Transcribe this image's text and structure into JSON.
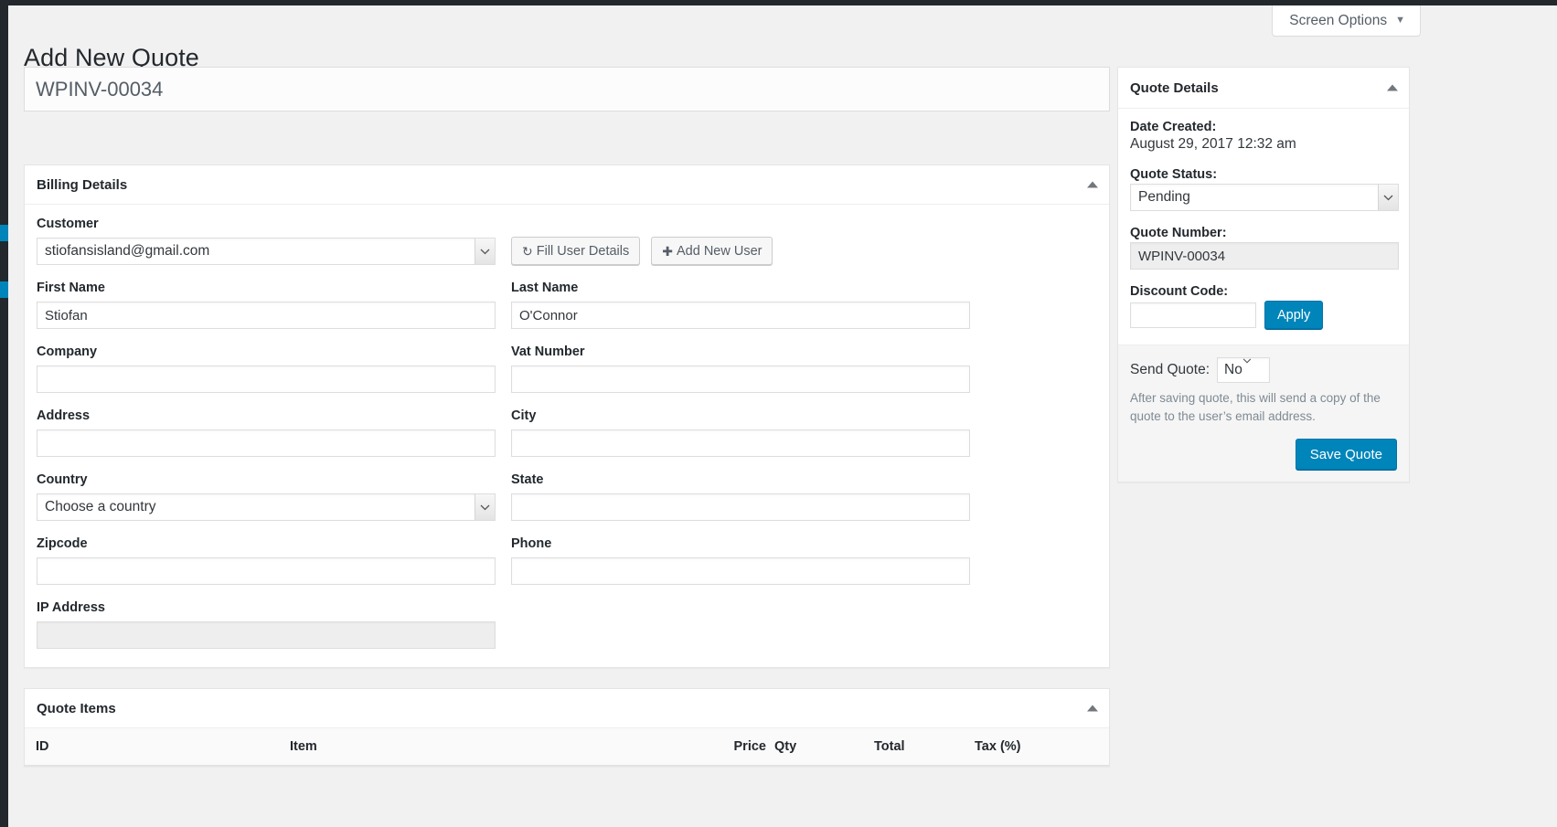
{
  "page": {
    "title": "Add New Quote",
    "quote_title_value": "WPINV-00034"
  },
  "screen_meta": {
    "screen_options_label": "Screen Options",
    "caret": "▼"
  },
  "billing": {
    "panel_title": "Billing Details",
    "customer": {
      "label": "Customer",
      "value": "stiofansisland@gmail.com",
      "fill_user_details_label": "Fill User Details",
      "fill_user_details_icon": "↻",
      "add_new_user_label": "Add New User",
      "add_new_user_icon": "✚"
    },
    "fields": {
      "first_name_label": "First Name",
      "first_name_value": "Stiofan",
      "last_name_label": "Last Name",
      "last_name_value": "O'Connor",
      "company_label": "Company",
      "company_value": "",
      "vat_number_label": "Vat Number",
      "vat_number_value": "",
      "address_label": "Address",
      "address_value": "",
      "city_label": "City",
      "city_value": "",
      "country_label": "Country",
      "country_value": "Choose a country",
      "state_label": "State",
      "state_value": "",
      "zipcode_label": "Zipcode",
      "zipcode_value": "",
      "phone_label": "Phone",
      "phone_value": "",
      "ip_address_label": "IP Address",
      "ip_address_value": ""
    }
  },
  "quote_items": {
    "panel_title": "Quote Items",
    "columns": [
      "ID",
      "Item",
      "Price",
      "Qty",
      "Total",
      "Tax (%)"
    ],
    "rows": []
  },
  "quote_details": {
    "panel_title": "Quote Details",
    "date_created_label": "Date Created:",
    "date_created_value": "August 29, 2017 12:32 am",
    "quote_status_label": "Quote Status:",
    "quote_status_value": "Pending",
    "quote_number_label": "Quote Number:",
    "quote_number_value": "WPINV-00034",
    "discount_code_label": "Discount Code:",
    "discount_code_value": "",
    "apply_label": "Apply",
    "send_quote_label": "Send Quote:",
    "send_quote_value": "No",
    "send_quote_description": "After saving quote, this will send a copy of the quote to the user’s email address.",
    "save_quote_label": "Save Quote"
  },
  "colors": {
    "accent": "#0085ba",
    "admin_bar": "#23282d",
    "page_bg": "#f1f1f1"
  }
}
